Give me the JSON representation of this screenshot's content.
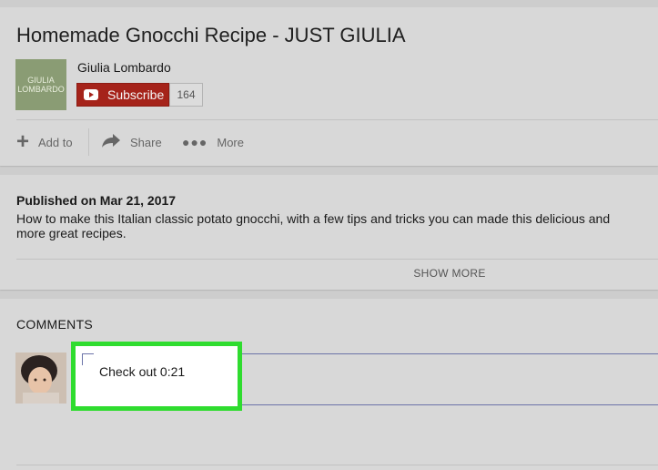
{
  "video": {
    "title": "Homemade Gnocchi Recipe - JUST GIULIA"
  },
  "channel": {
    "thumb_line1": "GIULIA",
    "thumb_line2": "LOMBARDO",
    "name": "Giulia Lombardo",
    "subscribe_label": "Subscribe",
    "subscriber_count": "164"
  },
  "actions": {
    "add_to": "Add to",
    "share": "Share",
    "more": "More"
  },
  "description": {
    "published": "Published on Mar 21, 2017",
    "line1": "How to make this Italian classic potato gnocchi, with a few tips and tricks you can made this delicious and",
    "line2": "more great recipes.",
    "show_more": "SHOW MORE"
  },
  "comments": {
    "heading": "COMMENTS",
    "input_value": "Check out 0:21"
  },
  "colors": {
    "subscribe_red": "#a5231a",
    "highlight_green": "#2fdc2f",
    "panel_gray": "#d8d8d8"
  }
}
